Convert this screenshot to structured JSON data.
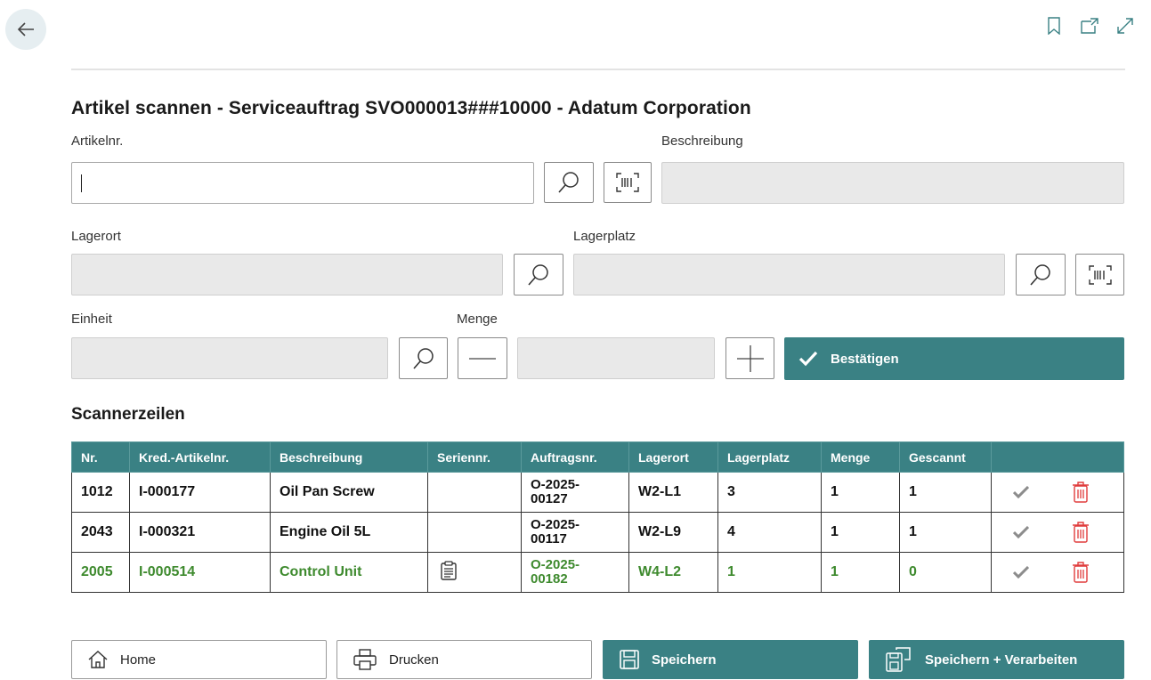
{
  "nav": {
    "back_icon": "arrow-left-icon",
    "top_icons": [
      "bookmark-icon",
      "open-in-new-icon",
      "expand-icon"
    ]
  },
  "page": {
    "title": "Artikel scannen - Serviceauftrag SVO000013###10000 - Adatum Corporation"
  },
  "form": {
    "item_no_label": "Artikelnr.",
    "item_no_value": "",
    "description_label": "Beschreibung",
    "location_label": "Lagerort",
    "bin_label": "Lagerplatz",
    "unit_label": "Einheit",
    "quantity_label": "Menge",
    "confirm_label": "Bestätigen"
  },
  "scanlines": {
    "title": "Scannerzeilen",
    "columns": [
      "Nr.",
      "Kred.-Artikelnr.",
      "Beschreibung",
      "Seriennr.",
      "Auftragsnr.",
      "Lagerort",
      "Lagerplatz",
      "Menge",
      "Gescannt"
    ],
    "rows": [
      {
        "nr": "1012",
        "vendor_item": "I-000177",
        "description": "Oil Pan Screw",
        "serial": "",
        "order_a": "O-2025-",
        "order_b": "00127",
        "location": "W2-L1",
        "bin": "3",
        "qty": "1",
        "scanned": "1"
      },
      {
        "nr": "2043",
        "vendor_item": "I-000321",
        "description": "Engine Oil 5L",
        "serial": "",
        "order_a": "O-2025-",
        "order_b": "00117",
        "location": "W2-L9",
        "bin": "4",
        "qty": "1",
        "scanned": "1"
      },
      {
        "nr": "2005",
        "vendor_item": "I-000514",
        "description": "Control Unit",
        "serial": "clipboard-icon",
        "order_a": "O-2025-",
        "order_b": "00182",
        "location": "W4-L2",
        "bin": "1",
        "qty": "1",
        "scanned": "0"
      }
    ]
  },
  "footer": {
    "home_label": "Home",
    "print_label": "Drucken",
    "save_label": "Speichern",
    "save_process_label": "Speichern + Verarbeiten"
  },
  "colors": {
    "accent": "#3a8184",
    "completed": "#3e8a2e",
    "delete": "#e03c3c"
  }
}
